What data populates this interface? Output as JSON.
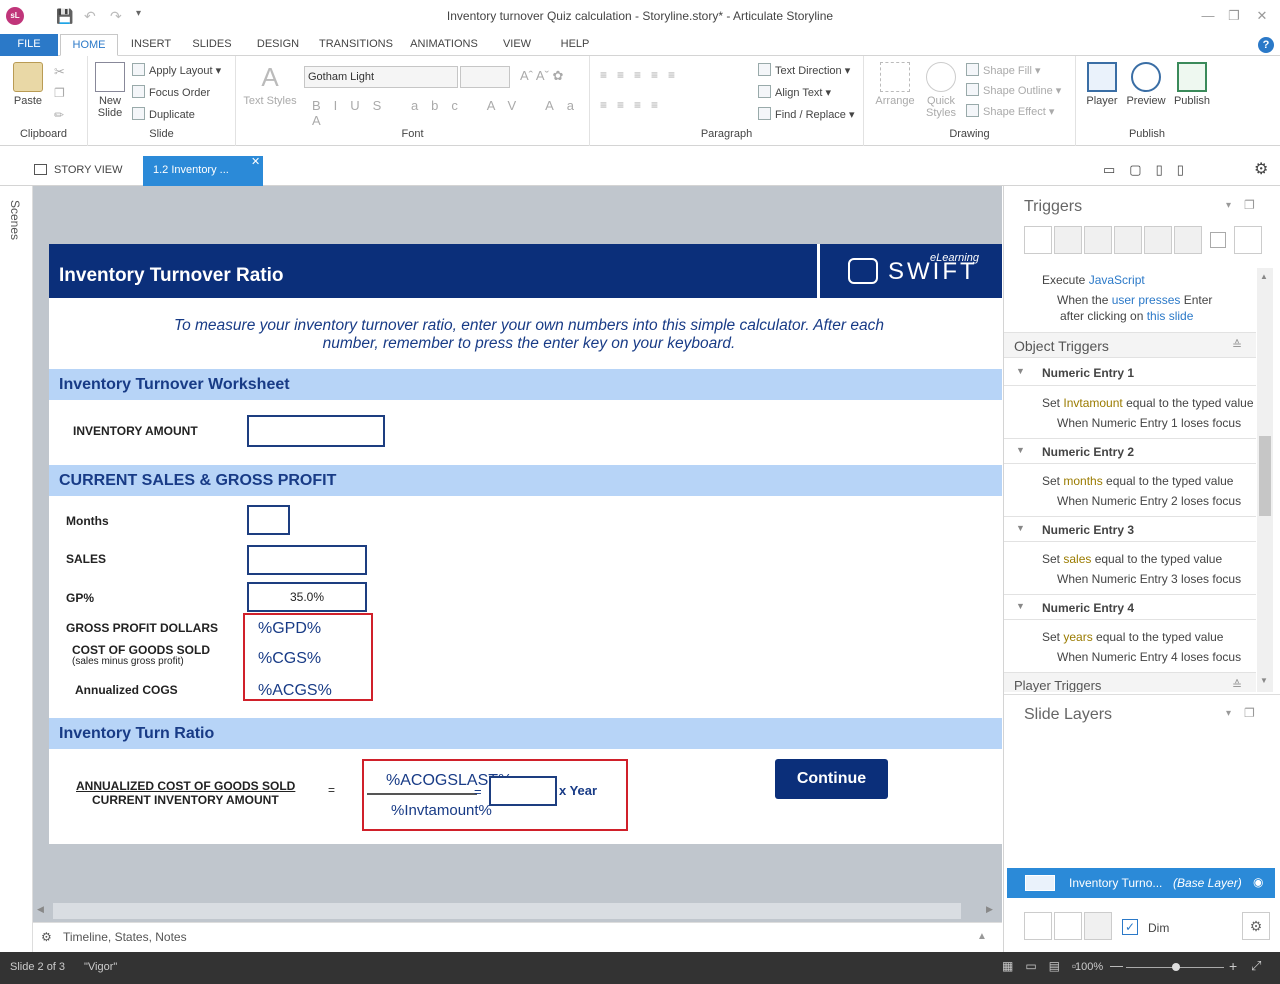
{
  "app": {
    "logo": "sL",
    "title": "Inventory turnover Quiz calculation - Storyline.story* - Articulate Storyline"
  },
  "ribbon_tabs": [
    "FILE",
    "HOME",
    "INSERT",
    "SLIDES",
    "DESIGN",
    "TRANSITIONS",
    "ANIMATIONS",
    "VIEW",
    "HELP"
  ],
  "clipboard": {
    "paste": "Paste",
    "label": "Clipboard"
  },
  "slide_group": {
    "new_slide": "New Slide",
    "apply_layout": "Apply Layout",
    "focus_order": "Focus Order",
    "duplicate": "Duplicate",
    "label": "Slide"
  },
  "font_group": {
    "text_styles": "Text Styles",
    "font_name": "Gotham Light",
    "label": "Font"
  },
  "paragraph": {
    "text_direction": "Text Direction",
    "align_text": "Align Text",
    "find_replace": "Find / Replace",
    "label": "Paragraph"
  },
  "drawing": {
    "arrange": "Arrange",
    "quick_styles": "Quick Styles",
    "shape_fill": "Shape Fill",
    "shape_outline": "Shape Outline",
    "shape_effect": "Shape Effect",
    "label": "Drawing"
  },
  "publish": {
    "player": "Player",
    "preview": "Preview",
    "publish": "Publish",
    "label": "Publish"
  },
  "view_tabs": {
    "story_view": "STORY VIEW",
    "slide_tab": "1.2 Inventory ..."
  },
  "scenes_label": "Scenes",
  "slide": {
    "header_title": "Inventory Turnover Ratio",
    "logo_text": "SWIFT",
    "logo_sub": "eLearning",
    "intro": "To measure your inventory turnover ratio, enter your own numbers into this simple calculator. After each number, remember to press the enter key on your keyboard.",
    "sec1": "Inventory  Turnover Worksheet",
    "inventory_amount": "INVENTORY AMOUNT",
    "sec2": "CURRENT SALES & GROSS PROFIT",
    "months": "Months",
    "sales": "SALES",
    "gp": "GP%",
    "gp_value": "35.0%",
    "gpd_label": "GROSS PROFIT DOLLARS",
    "cogs_label": "COST OF GOODS SOLD",
    "cogs_sub": "(sales minus gross profit)",
    "acogs_label": "Annualized COGS",
    "var_gpd": "%GPD%",
    "var_cgs": "%CGS%",
    "var_acgs": "%ACGS%",
    "sec3": "Inventory Turn Ratio",
    "ratio_num": "ANNUALIZED COST OF GOODS SOLD",
    "ratio_den": "CURRENT INVENTORY AMOUNT",
    "equals": "=",
    "var_acogs": "%ACOGSLAST%",
    "var_invt": "%Invtamount%",
    "eq2": "=",
    "x_year": "x  Year",
    "continue": "Continue"
  },
  "hscroll_label": "Timeline, States, Notes",
  "triggers": {
    "title": "Triggers",
    "exec_js_prefix": "Execute ",
    "exec_js": "JavaScript",
    "when_user_prefix": "When the ",
    "when_user": "user presses",
    "when_user_suffix": " Enter",
    "after_prefix": "after clicking on ",
    "after_link": "this slide",
    "object_triggers": "Object Triggers",
    "entries": [
      {
        "name": "Numeric Entry 1",
        "set_prefix": "Set ",
        "var": "Invtamount",
        "set_suffix": " equal to the typed value",
        "when": "When Numeric Entry 1 loses focus"
      },
      {
        "name": "Numeric Entry 2",
        "set_prefix": "Set ",
        "var": "months",
        "set_suffix": " equal to the typed value",
        "when": "When Numeric Entry 2 loses focus"
      },
      {
        "name": "Numeric Entry 3",
        "set_prefix": "Set ",
        "var": "sales",
        "set_suffix": " equal to the typed value",
        "when": "When Numeric Entry 3 loses focus"
      },
      {
        "name": "Numeric Entry 4",
        "set_prefix": "Set ",
        "var": "years",
        "set_suffix": " equal to the typed value",
        "when": "When Numeric Entry 4 loses focus"
      }
    ],
    "player_triggers": "Player Triggers"
  },
  "layers": {
    "title": "Slide Layers",
    "base_name": "Inventory Turno...",
    "base_tag": "(Base Layer)",
    "dim": "Dim"
  },
  "status": {
    "slide": "Slide 2 of 3",
    "theme": "\"Vigor\"",
    "zoom": "100%"
  }
}
